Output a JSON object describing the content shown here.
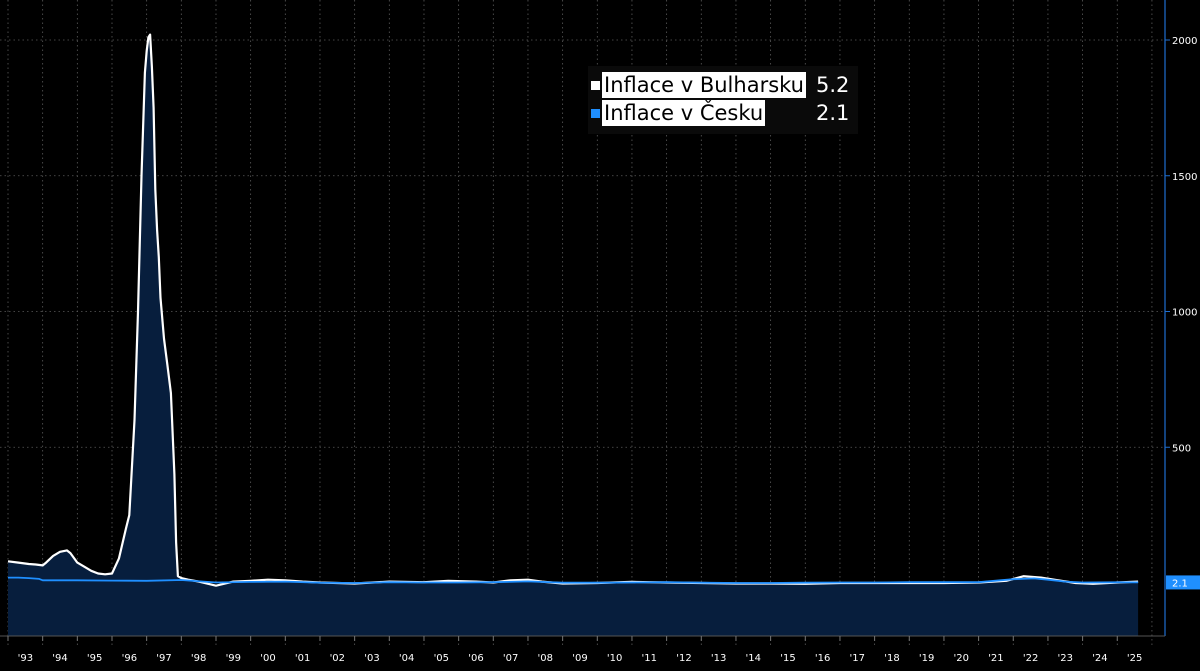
{
  "chart_data": {
    "type": "area",
    "title": "",
    "xlabel": "",
    "ylabel": "",
    "ylim": [
      -200,
      2150
    ],
    "yticks": [
      500,
      1000,
      1500,
      2000
    ],
    "x_tick_labels": [
      "'93",
      "'94",
      "'95",
      "'96",
      "'97",
      "'98",
      "'99",
      "'00",
      "'01",
      "'02",
      "'03",
      "'04",
      "'05",
      "'06",
      "'07",
      "'08",
      "'09",
      "'10",
      "'11",
      "'12",
      "'13",
      "'14",
      "'15",
      "'16",
      "'17",
      "'18",
      "'19",
      "'20",
      "'21",
      "'22",
      "'23",
      "'24",
      "'25"
    ],
    "xlim": [
      1993.0,
      2025.8
    ],
    "grid": true,
    "legend_position": "top-center",
    "last_value_label": "2.1",
    "series": [
      {
        "name": "Inflace v Bulharsku",
        "last": "5.2",
        "color": "#ffffff",
        "x": [
          1993.0,
          1993.3,
          1993.6,
          1993.8,
          1994.0,
          1994.1,
          1994.3,
          1994.5,
          1994.7,
          1994.8,
          1995.0,
          1995.2,
          1995.4,
          1995.6,
          1995.8,
          1996.0,
          1996.2,
          1996.4,
          1996.5,
          1996.65,
          1996.75,
          1996.85,
          1996.95,
          1997.0,
          1997.05,
          1997.1,
          1997.15,
          1997.2,
          1997.25,
          1997.3,
          1997.35,
          1997.4,
          1997.5,
          1997.6,
          1997.7,
          1997.8,
          1997.85,
          1997.9,
          1998.0,
          1998.2,
          1998.5,
          1999.0,
          1999.5,
          2000.0,
          2000.5,
          2001.0,
          2001.5,
          2002.0,
          2003.0,
          2004.0,
          2005.0,
          2005.7,
          2006.5,
          2007.0,
          2007.5,
          2008.0,
          2008.4,
          2009.0,
          2010.0,
          2011.0,
          2012.0,
          2013.0,
          2014.0,
          2015.0,
          2016.0,
          2017.0,
          2018.0,
          2019.0,
          2020.0,
          2021.0,
          2021.8,
          2022.3,
          2022.8,
          2023.3,
          2023.8,
          2024.3,
          2025.0,
          2025.6
        ],
        "values": [
          80,
          75,
          70,
          68,
          65,
          75,
          100,
          115,
          120,
          110,
          75,
          60,
          45,
          35,
          32,
          35,
          90,
          200,
          250,
          600,
          1000,
          1500,
          1880,
          1960,
          2010,
          2020,
          1900,
          1750,
          1450,
          1300,
          1200,
          1050,
          900,
          800,
          700,
          400,
          150,
          25,
          18,
          12,
          5,
          -10,
          5,
          8,
          12,
          10,
          5,
          2,
          -2,
          5,
          3,
          8,
          5,
          2,
          10,
          12,
          5,
          -2,
          0,
          4,
          2,
          0,
          -2,
          -2,
          -3,
          0,
          0,
          0,
          0,
          2,
          8,
          25,
          20,
          10,
          0,
          -3,
          2,
          5.2
        ]
      },
      {
        "name": "Inflace v Česku",
        "last": "2.1",
        "color": "#1f8fff",
        "x": [
          1993.0,
          1993.3,
          1993.6,
          1993.9,
          1994.0,
          1995.0,
          1996.0,
          1997.0,
          1998.0,
          1999.0,
          2000.0,
          2001.0,
          2002.0,
          2003.0,
          2004.0,
          2005.0,
          2006.0,
          2007.0,
          2008.0,
          2009.0,
          2010.0,
          2011.0,
          2012.0,
          2013.0,
          2014.0,
          2015.0,
          2016.0,
          2017.0,
          2018.0,
          2019.0,
          2020.0,
          2021.0,
          2022.0,
          2022.6,
          2023.0,
          2023.5,
          2024.0,
          2025.0,
          2025.6
        ],
        "values": [
          20,
          20,
          18,
          15,
          10,
          10,
          9,
          8,
          11,
          2,
          4,
          5,
          1,
          0,
          3,
          2,
          2,
          3,
          6,
          1,
          1,
          2,
          3,
          1,
          0,
          0,
          1,
          2,
          2,
          3,
          3,
          3,
          14,
          17,
          12,
          5,
          2,
          2.5,
          2.1
        ]
      }
    ]
  }
}
